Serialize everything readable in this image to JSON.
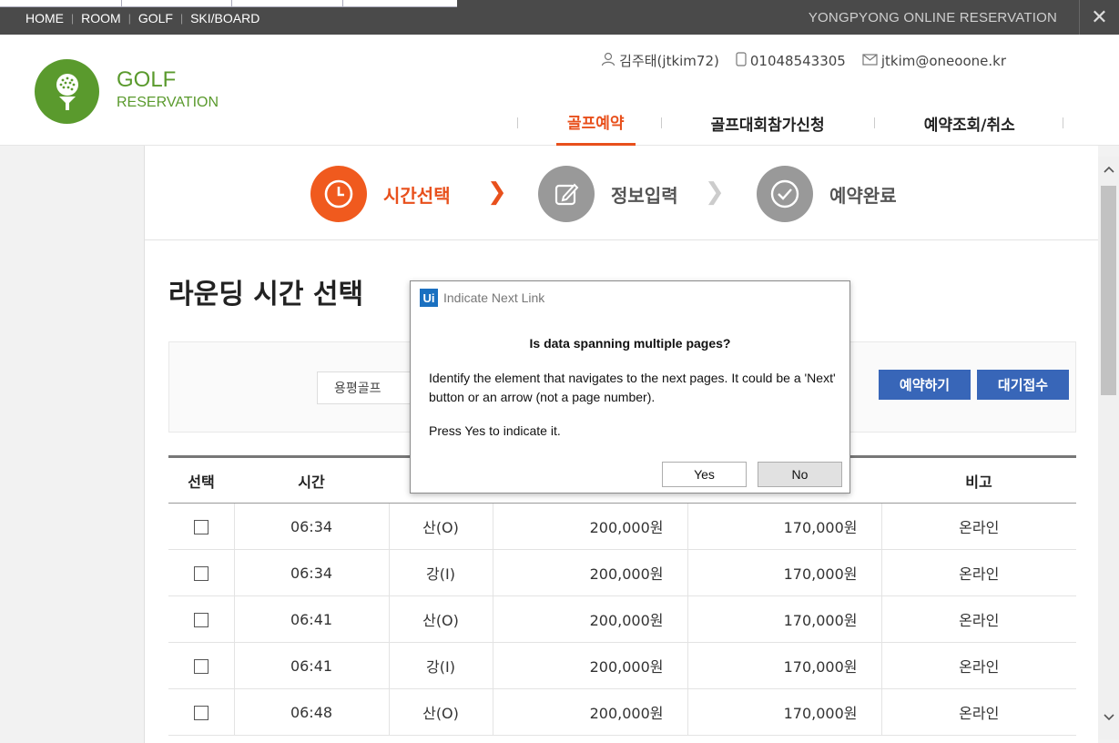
{
  "topbar": {
    "links": [
      "HOME",
      "ROOM",
      "GOLF",
      "SKI/BOARD"
    ],
    "brand": "YONGPYONG ONLINE RESERVATION",
    "close_icon": "close-icon"
  },
  "header": {
    "logo_title": "GOLF",
    "logo_subtitle": "RESERVATION",
    "user_name": "김주태(jtkim72)",
    "phone": "01048543305",
    "email": "jtkim@oneoone.kr",
    "nav": [
      "골프예약",
      "골프대회참가신청",
      "예약조회/취소"
    ],
    "active_nav_index": 0
  },
  "steps": [
    {
      "label": "시간선택",
      "icon": "clock-icon",
      "state": "active"
    },
    {
      "label": "정보입력",
      "icon": "edit-icon",
      "state": "inactive"
    },
    {
      "label": "예약완료",
      "icon": "check-icon",
      "state": "inactive"
    }
  ],
  "page_title": "라운딩 시간 선택",
  "search": {
    "course_value": "용평골프",
    "reserve_button": "예약하기",
    "waitlist_button": "대기접수"
  },
  "table": {
    "headers": [
      "선택",
      "시간",
      "",
      "",
      "",
      "비고"
    ],
    "rows": [
      {
        "time": "06:34",
        "course": "산(O)",
        "price1": "200,000원",
        "price2": "170,000원",
        "note": "온라인"
      },
      {
        "time": "06:34",
        "course": "강(I)",
        "price1": "200,000원",
        "price2": "170,000원",
        "note": "온라인"
      },
      {
        "time": "06:41",
        "course": "산(O)",
        "price1": "200,000원",
        "price2": "170,000원",
        "note": "온라인"
      },
      {
        "time": "06:41",
        "course": "강(I)",
        "price1": "200,000원",
        "price2": "170,000원",
        "note": "온라인"
      },
      {
        "time": "06:48",
        "course": "산(O)",
        "price1": "200,000원",
        "price2": "170,000원",
        "note": "온라인"
      }
    ]
  },
  "dialog": {
    "app_badge": "Ui",
    "title": "Indicate Next Link",
    "heading": "Is data spanning multiple pages?",
    "body1": "Identify the element that navigates to the next pages. It could be a 'Next' button or an arrow (not a page number).",
    "body2": "Press Yes to indicate it.",
    "yes": "Yes",
    "no": "No"
  },
  "colors": {
    "accent_orange": "#e8501c",
    "brand_green": "#5a9a2d",
    "button_blue": "#3866b8"
  }
}
